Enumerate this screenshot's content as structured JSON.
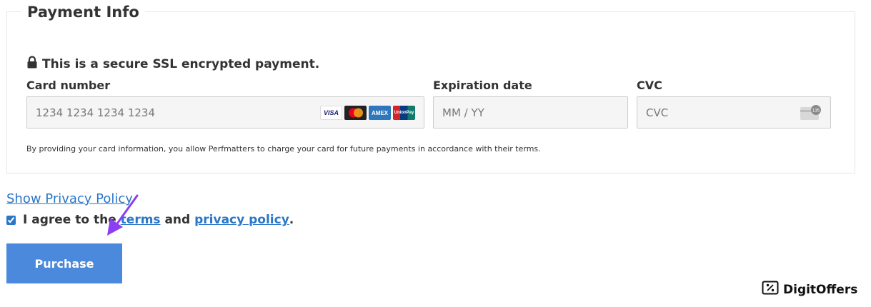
{
  "section": {
    "title": "Payment Info"
  },
  "secure_notice": {
    "text": "This is a secure SSL encrypted payment.",
    "icon": "lock-icon"
  },
  "card_number": {
    "label": "Card number",
    "placeholder": "1234 1234 1234 1234",
    "brands": [
      "VISA",
      "Mastercard",
      "AMEX",
      "UnionPay"
    ]
  },
  "expiration": {
    "label": "Expiration date",
    "placeholder": "MM / YY"
  },
  "cvc": {
    "label": "CVC",
    "placeholder": "CVC",
    "icon_text": "135"
  },
  "authorization_notice": "By providing your card information, you allow Perfmatters to charge your card for future payments in accordance with their terms.",
  "privacy_toggle": "Show Privacy Policy",
  "agreement": {
    "checked": true,
    "prefix": "I agree to the ",
    "terms": "terms",
    "middle": " and ",
    "privacy": "privacy policy",
    "suffix": "."
  },
  "purchase_button": "Purchase",
  "watermark": "DigitOffers",
  "colors": {
    "link": "#2a76c8",
    "button": "#4a89dc",
    "arrow": "#8b3ff0"
  }
}
